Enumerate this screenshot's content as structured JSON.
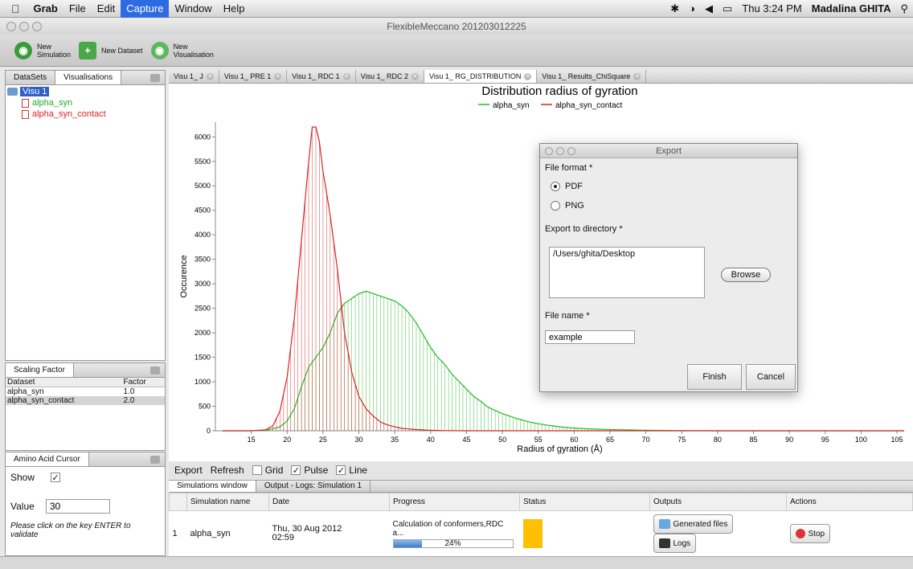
{
  "menubar": {
    "apple_icon": "apple-icon",
    "items": [
      {
        "label": "Grab"
      },
      {
        "label": "File"
      },
      {
        "label": "Edit"
      },
      {
        "label": "Capture"
      },
      {
        "label": "Window"
      },
      {
        "label": "Help"
      }
    ],
    "clock": "Thu 3:24 PM",
    "user": "Madalina GHITA",
    "search_icon": "search-icon"
  },
  "window": {
    "title": "FlexibleMeccano 201203012225"
  },
  "toolbar": {
    "new_simulation": "New\nSimulation",
    "new_dataset": "New Dataset",
    "new_visualisation": "New\nVisualisation"
  },
  "left_panel": {
    "tabs": [
      {
        "label": "DataSets"
      },
      {
        "label": "Visualisations"
      }
    ],
    "tree": {
      "root": "Visu 1",
      "children": [
        {
          "label": "alpha_syn",
          "color": "#22aa22"
        },
        {
          "label": "alpha_syn_contact",
          "color": "#dd2222"
        }
      ]
    }
  },
  "scaling": {
    "tab": "Scaling Factor",
    "headers": [
      "Dataset",
      "Factor"
    ],
    "rows": [
      [
        "alpha_syn",
        "1.0"
      ],
      [
        "alpha_syn_contact",
        "2.0"
      ]
    ]
  },
  "cursor": {
    "tab": "Amino Acid Cursor",
    "show_label": "Show",
    "value_label": "Value",
    "value": "30",
    "hint": "Please click on the key ENTER to validate"
  },
  "doc_tabs": [
    {
      "label": "Visu 1_ J"
    },
    {
      "label": "Visu 1_ PRE 1"
    },
    {
      "label": "Visu 1_ RDC 1"
    },
    {
      "label": "Visu 1_ RDC 2"
    },
    {
      "label": "Visu 1_ RG_DISTRIBUTION"
    },
    {
      "label": "Visu 1_ Results_ChiSquare"
    }
  ],
  "chart_tools": {
    "export": "Export",
    "refresh": "Refresh",
    "grid": "Grid",
    "pulse": "Pulse",
    "line": "Line"
  },
  "bottom": {
    "tabs": [
      {
        "label": "Simulations window"
      },
      {
        "label": "Output - Logs: Simulation 1"
      }
    ],
    "headers": [
      "",
      "Simulation name",
      "Date",
      "Progress",
      "Status",
      "Outputs",
      "Actions"
    ],
    "row": {
      "index": "1",
      "name": "alpha_syn",
      "date": "Thu, 30 Aug 2012\n02:59",
      "progress_text": "Calculation of conformers,RDC a...",
      "progress_pct": 24,
      "progress_label": "24%",
      "status_color": "#ffc000",
      "generated_files": "Generated files",
      "logs": "Logs",
      "stop": "Stop"
    }
  },
  "export_dialog": {
    "title": "Export",
    "file_format_label": "File format *",
    "pdf": "PDF",
    "png": "PNG",
    "selected_format": "PDF",
    "dir_label": "Export to directory *",
    "dir_value": "/Users/ghita/Desktop",
    "browse": "Browse",
    "file_name_label": "File name *",
    "file_name_value": "example",
    "finish": "Finish",
    "cancel": "Cancel"
  },
  "chart_data": {
    "type": "bar",
    "title": "Distribution radius of gyration",
    "xlabel": "Radius of gyration (Å)",
    "ylabel": "Occurence",
    "xlim": [
      10,
      106
    ],
    "ylim": [
      0,
      6300
    ],
    "xticks": [
      15,
      20,
      25,
      30,
      35,
      40,
      45,
      50,
      55,
      60,
      65,
      70,
      75,
      80,
      85,
      90,
      95,
      100,
      105
    ],
    "yticks": [
      0,
      500,
      1000,
      1500,
      2000,
      2500,
      3000,
      3500,
      4000,
      4500,
      5000,
      5500,
      6000
    ],
    "legend_position": "top-center",
    "series": [
      {
        "name": "alpha_syn",
        "color": "#22bb22",
        "points": [
          [
            15,
            0
          ],
          [
            17,
            5
          ],
          [
            19,
            80
          ],
          [
            20,
            200
          ],
          [
            21,
            450
          ],
          [
            22,
            900
          ],
          [
            23,
            1300
          ],
          [
            24,
            1500
          ],
          [
            25,
            1700
          ],
          [
            26,
            2000
          ],
          [
            27,
            2400
          ],
          [
            28,
            2600
          ],
          [
            29,
            2700
          ],
          [
            30,
            2800
          ],
          [
            31,
            2850
          ],
          [
            32,
            2800
          ],
          [
            33,
            2750
          ],
          [
            34,
            2700
          ],
          [
            35,
            2650
          ],
          [
            36,
            2550
          ],
          [
            37,
            2400
          ],
          [
            38,
            2200
          ],
          [
            39,
            1950
          ],
          [
            40,
            1700
          ],
          [
            41,
            1500
          ],
          [
            42,
            1350
          ],
          [
            43,
            1150
          ],
          [
            44,
            1000
          ],
          [
            45,
            850
          ],
          [
            46,
            700
          ],
          [
            47,
            600
          ],
          [
            48,
            480
          ],
          [
            50,
            350
          ],
          [
            52,
            250
          ],
          [
            54,
            170
          ],
          [
            56,
            120
          ],
          [
            58,
            80
          ],
          [
            60,
            55
          ],
          [
            62,
            40
          ],
          [
            65,
            25
          ],
          [
            70,
            10
          ],
          [
            75,
            3
          ],
          [
            80,
            0
          ],
          [
            105,
            0
          ]
        ]
      },
      {
        "name": "alpha_syn_contact",
        "color": "#dd2222",
        "points": [
          [
            15,
            0
          ],
          [
            17,
            20
          ],
          [
            18,
            100
          ],
          [
            19,
            400
          ],
          [
            20,
            1100
          ],
          [
            21,
            2300
          ],
          [
            22,
            3900
          ],
          [
            23,
            5500
          ],
          [
            23.5,
            6200
          ],
          [
            24,
            6200
          ],
          [
            24.5,
            5900
          ],
          [
            25,
            5300
          ],
          [
            26,
            4400
          ],
          [
            27,
            3300
          ],
          [
            28,
            2000
          ],
          [
            29,
            1200
          ],
          [
            30,
            700
          ],
          [
            31,
            450
          ],
          [
            32,
            300
          ],
          [
            33,
            180
          ],
          [
            34,
            120
          ],
          [
            35,
            80
          ],
          [
            36,
            50
          ],
          [
            38,
            25
          ],
          [
            40,
            10
          ],
          [
            42,
            3
          ],
          [
            45,
            0
          ],
          [
            105,
            0
          ]
        ]
      }
    ]
  }
}
